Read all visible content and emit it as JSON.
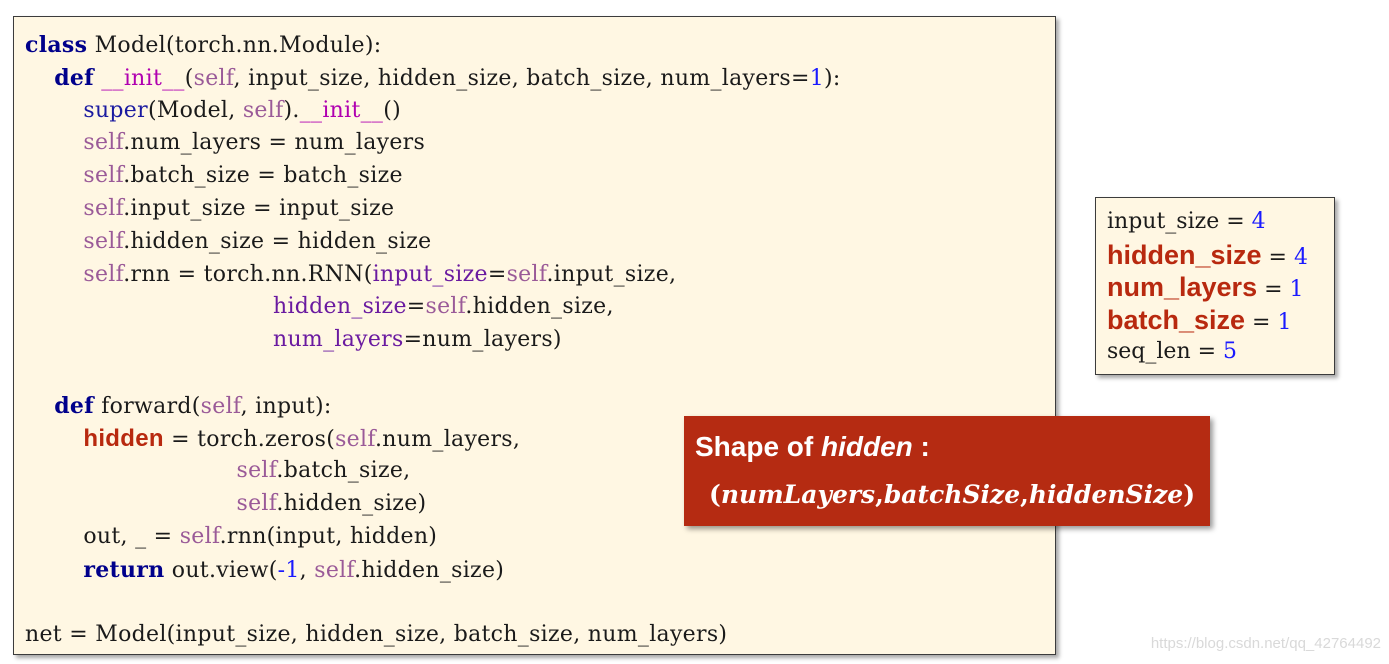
{
  "code": {
    "lines": [
      {
        "tokens": [
          {
            "t": "class",
            "c": "kw"
          },
          {
            "t": " Model(torch.nn.Module):",
            "c": ""
          }
        ]
      },
      {
        "tokens": [
          {
            "t": "    ",
            "c": ""
          },
          {
            "t": "def",
            "c": "kw"
          },
          {
            "t": " ",
            "c": ""
          },
          {
            "t": "__init__",
            "c": "magic"
          },
          {
            "t": "(",
            "c": ""
          },
          {
            "t": "self",
            "c": "self"
          },
          {
            "t": ", input_size, hidden_size, batch_size, num_layers=",
            "c": ""
          },
          {
            "t": "1",
            "c": "num"
          },
          {
            "t": "):",
            "c": ""
          }
        ]
      },
      {
        "tokens": [
          {
            "t": "        ",
            "c": ""
          },
          {
            "t": "super",
            "c": "bi"
          },
          {
            "t": "(Model, ",
            "c": ""
          },
          {
            "t": "self",
            "c": "self"
          },
          {
            "t": ").",
            "c": ""
          },
          {
            "t": "__init__",
            "c": "magic"
          },
          {
            "t": "()",
            "c": ""
          }
        ]
      },
      {
        "tokens": [
          {
            "t": "        ",
            "c": ""
          },
          {
            "t": "self",
            "c": "self"
          },
          {
            "t": ".num_layers = num_layers",
            "c": ""
          }
        ]
      },
      {
        "tokens": [
          {
            "t": "        ",
            "c": ""
          },
          {
            "t": "self",
            "c": "self"
          },
          {
            "t": ".batch_size = batch_size",
            "c": ""
          }
        ]
      },
      {
        "tokens": [
          {
            "t": "        ",
            "c": ""
          },
          {
            "t": "self",
            "c": "self"
          },
          {
            "t": ".input_size = input_size",
            "c": ""
          }
        ]
      },
      {
        "tokens": [
          {
            "t": "        ",
            "c": ""
          },
          {
            "t": "self",
            "c": "self"
          },
          {
            "t": ".hidden_size = hidden_size",
            "c": ""
          }
        ]
      },
      {
        "tokens": [
          {
            "t": "        ",
            "c": ""
          },
          {
            "t": "self",
            "c": "self"
          },
          {
            "t": ".rnn = torch.nn.RNN(",
            "c": ""
          },
          {
            "t": "input_size",
            "c": "kwarg"
          },
          {
            "t": "=",
            "c": ""
          },
          {
            "t": "self",
            "c": "self"
          },
          {
            "t": ".input_size,",
            "c": ""
          }
        ]
      },
      {
        "tokens": [
          {
            "t": "                                  ",
            "c": ""
          },
          {
            "t": "hidden_size",
            "c": "kwarg"
          },
          {
            "t": "=",
            "c": ""
          },
          {
            "t": "self",
            "c": "self"
          },
          {
            "t": ".hidden_size,",
            "c": ""
          }
        ]
      },
      {
        "tokens": [
          {
            "t": "                                  ",
            "c": ""
          },
          {
            "t": "num_layers",
            "c": "kwarg"
          },
          {
            "t": "=num_layers)",
            "c": ""
          }
        ]
      },
      {
        "tokens": []
      },
      {
        "tokens": [
          {
            "t": "    ",
            "c": ""
          },
          {
            "t": "def",
            "c": "kw"
          },
          {
            "t": " forward(",
            "c": ""
          },
          {
            "t": "self",
            "c": "self"
          },
          {
            "t": ", input):",
            "c": ""
          }
        ]
      },
      {
        "tokens": [
          {
            "t": "        ",
            "c": ""
          },
          {
            "t": "hidden",
            "c": "hl"
          },
          {
            "t": " = torch.zeros(",
            "c": ""
          },
          {
            "t": "self",
            "c": "self"
          },
          {
            "t": ".num_layers,",
            "c": ""
          }
        ]
      },
      {
        "tokens": [
          {
            "t": "                             ",
            "c": ""
          },
          {
            "t": "self",
            "c": "self"
          },
          {
            "t": ".batch_size,",
            "c": ""
          }
        ]
      },
      {
        "tokens": [
          {
            "t": "                             ",
            "c": ""
          },
          {
            "t": "self",
            "c": "self"
          },
          {
            "t": ".hidden_size)",
            "c": ""
          }
        ]
      },
      {
        "tokens": [
          {
            "t": "        out, _ = ",
            "c": ""
          },
          {
            "t": "self",
            "c": "self"
          },
          {
            "t": ".rnn(input, hidden)",
            "c": ""
          }
        ]
      },
      {
        "tokens": [
          {
            "t": "        ",
            "c": ""
          },
          {
            "t": "return",
            "c": "kw"
          },
          {
            "t": " out.view(",
            "c": ""
          },
          {
            "t": "-1",
            "c": "num"
          },
          {
            "t": ", ",
            "c": ""
          },
          {
            "t": "self",
            "c": "self"
          },
          {
            "t": ".hidden_size)",
            "c": ""
          }
        ]
      },
      {
        "tokens": []
      },
      {
        "tokens": [
          {
            "t": "net = Model(input_size, hidden_size, batch_size, num_layers)",
            "c": ""
          }
        ]
      }
    ]
  },
  "params": [
    {
      "name": "input_size",
      "value": "4",
      "emphasized": false
    },
    {
      "name": "hidden_size",
      "value": "4",
      "emphasized": true
    },
    {
      "name": "num_layers",
      "value": "1",
      "emphasized": true
    },
    {
      "name": "batch_size",
      "value": "1",
      "emphasized": true
    },
    {
      "name": "seq_len",
      "value": "5",
      "emphasized": false
    }
  ],
  "callout": {
    "title_prefix": "Shape of ",
    "title_emph": "hidden",
    "title_suffix": " :",
    "formula_open": "(",
    "formula_parts": [
      "numLayers",
      "batchSize",
      "hiddenSize"
    ],
    "formula_close": ")"
  },
  "colors": {
    "code_background": "#fff7e3",
    "callout_background": "#b52b12",
    "highlight_text": "#b8290f",
    "keyword": "#00008b",
    "self": "#9a5a98",
    "number": "#1a1aff"
  },
  "watermark": "https://blog.csdn.net/qq_42764492"
}
